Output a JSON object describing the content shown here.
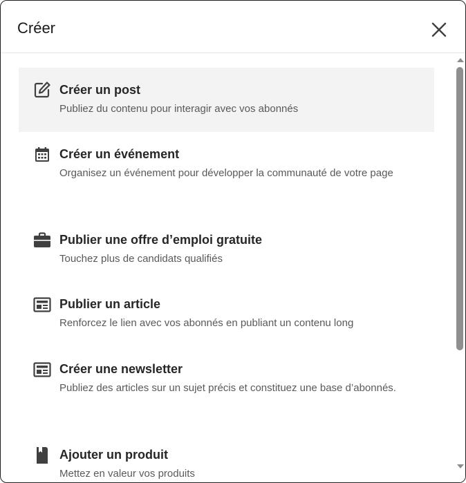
{
  "dialog": {
    "title": "Créer",
    "close_icon": "close-icon"
  },
  "items": [
    {
      "title": "Créer un post",
      "description": "Publiez du contenu pour interagir avec vos abonnés",
      "icon": "edit-icon",
      "active": true
    },
    {
      "title": "Créer un événement",
      "description": "Organisez un événement pour développer la communauté de votre page",
      "icon": "calendar-icon",
      "active": false
    },
    {
      "title": "Publier une offre d’emploi gratuite",
      "description": "Touchez plus de candidats qualifiés",
      "icon": "briefcase-icon",
      "active": false
    },
    {
      "title": "Publier un article",
      "description": "Renforcez le lien avec vos abonnés en publiant un contenu long",
      "icon": "article-icon",
      "active": false
    },
    {
      "title": "Créer une newsletter",
      "description": "Publiez des articles sur un sujet précis et constituez une base d’abonnés.",
      "icon": "newsletter-icon",
      "active": false
    },
    {
      "title": "Ajouter un produit",
      "description": "Mettez en valeur vos produits",
      "icon": "product-icon",
      "active": false
    }
  ],
  "colors": {
    "title_text": "#262626",
    "desc_text": "#595959",
    "active_bg": "#f3f3f3",
    "icon": "#404040"
  }
}
